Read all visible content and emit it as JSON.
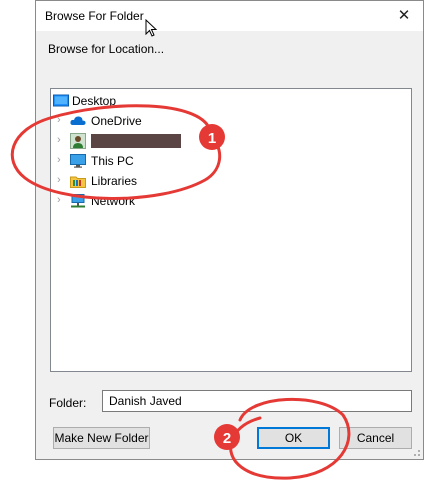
{
  "window": {
    "title": "Browse For Folder",
    "close_glyph": "✕"
  },
  "instruction": "Browse for Location...",
  "tree": {
    "items": [
      {
        "label": "Desktop",
        "icon": "desktop-icon",
        "expandable": false
      },
      {
        "label": "OneDrive",
        "icon": "cloud-icon",
        "expandable": true
      },
      {
        "label": "",
        "icon": "user-icon",
        "expandable": true,
        "redacted": true
      },
      {
        "label": "This PC",
        "icon": "monitor-icon",
        "expandable": true
      },
      {
        "label": "Libraries",
        "icon": "library-icon",
        "expandable": true
      },
      {
        "label": "Network",
        "icon": "network-icon",
        "expandable": true
      }
    ],
    "chevron": "›"
  },
  "folder": {
    "label": "Folder:",
    "value": "Danish Javed"
  },
  "buttons": {
    "new_folder": "Make New Folder",
    "ok": "OK",
    "cancel": "Cancel"
  },
  "annotations": {
    "marker1": "1",
    "marker2": "2",
    "color": "#e53935"
  }
}
